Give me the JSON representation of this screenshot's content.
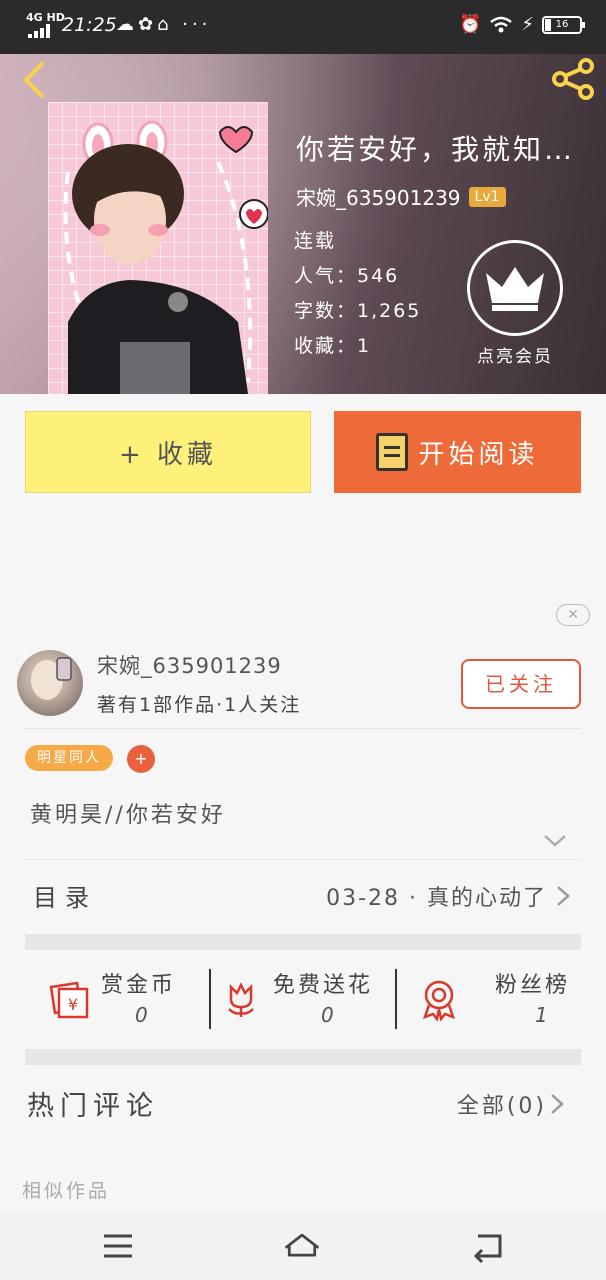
{
  "status_bar": {
    "network": "4G HD",
    "time": "21:25",
    "battery": "16"
  },
  "book": {
    "title": "你若安好，我就知…",
    "author": "宋婉_635901239",
    "level": "Lv1",
    "status": "连载",
    "popularity": "人气：546",
    "word_count": "字数：1,265",
    "favorites": "收藏：1",
    "vip_label": "点亮会员"
  },
  "actions": {
    "favorite_label": "+ 收藏",
    "read_label": "开始阅读"
  },
  "ad": {
    "close_label": "✕"
  },
  "author_info": {
    "name": "宋婉_635901239",
    "stats": "著有1部作品·1人关注",
    "follow_label": "已关注"
  },
  "tags": {
    "items": [
      "明星同人"
    ],
    "add_label": "+"
  },
  "intro": "黄明昊//你若安好",
  "toc": {
    "label": "目录",
    "latest": "03-28 · 真的心动了"
  },
  "stats": [
    {
      "label": "赏金币",
      "value": "0"
    },
    {
      "label": "免费送花",
      "value": "0"
    },
    {
      "label": "粉丝榜",
      "value": "1"
    }
  ],
  "comments": {
    "label": "热门评论",
    "all_label": "全部(0)"
  },
  "similar_label": "相似作品",
  "colors": {
    "favorite_bg": "#fdf17a",
    "read_bg": "#ef6a39",
    "accent": "#e2573d",
    "tag_bg": "#f5a947",
    "level_badge": "#e8a83a"
  }
}
